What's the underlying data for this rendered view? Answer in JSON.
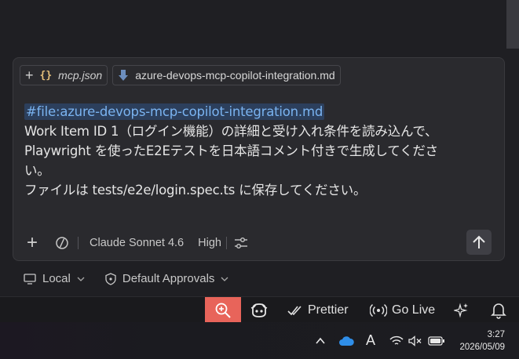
{
  "chat": {
    "attachments": [
      {
        "name": "mcp.json",
        "icon": "json-braces-icon"
      },
      {
        "name": "azure-devops-mcp-copilot-integration.md",
        "icon": "markdown-file-icon"
      }
    ],
    "prompt": {
      "file_ref": "#file:azure-devops-mcp-copilot-integration.md",
      "line1": "Work Item ID 1（ログイン機能）の詳細と受け入れ条件を読み込んで、",
      "line2": "Playwright を使ったE2Eテストを日本語コメント付きで生成してくださ",
      "line3": "い。",
      "line4": "ファイルは tests/e2e/login.spec.ts に保存してください。"
    },
    "toolbar": {
      "model": "Claude Sonnet 4.6",
      "mode": "High"
    }
  },
  "session": {
    "location": "Local",
    "approvals": "Default Approvals"
  },
  "statusbar": {
    "prettier": "Prettier",
    "go_live": "Go Live"
  },
  "taskbar": {
    "time": "3:27",
    "date": "2026/05/09",
    "ime": "A"
  },
  "colors": {
    "accent_zoom": "#e8645a",
    "file_ref_bg": "#2c3f5c",
    "file_ref_fg": "#7ab3f0"
  }
}
